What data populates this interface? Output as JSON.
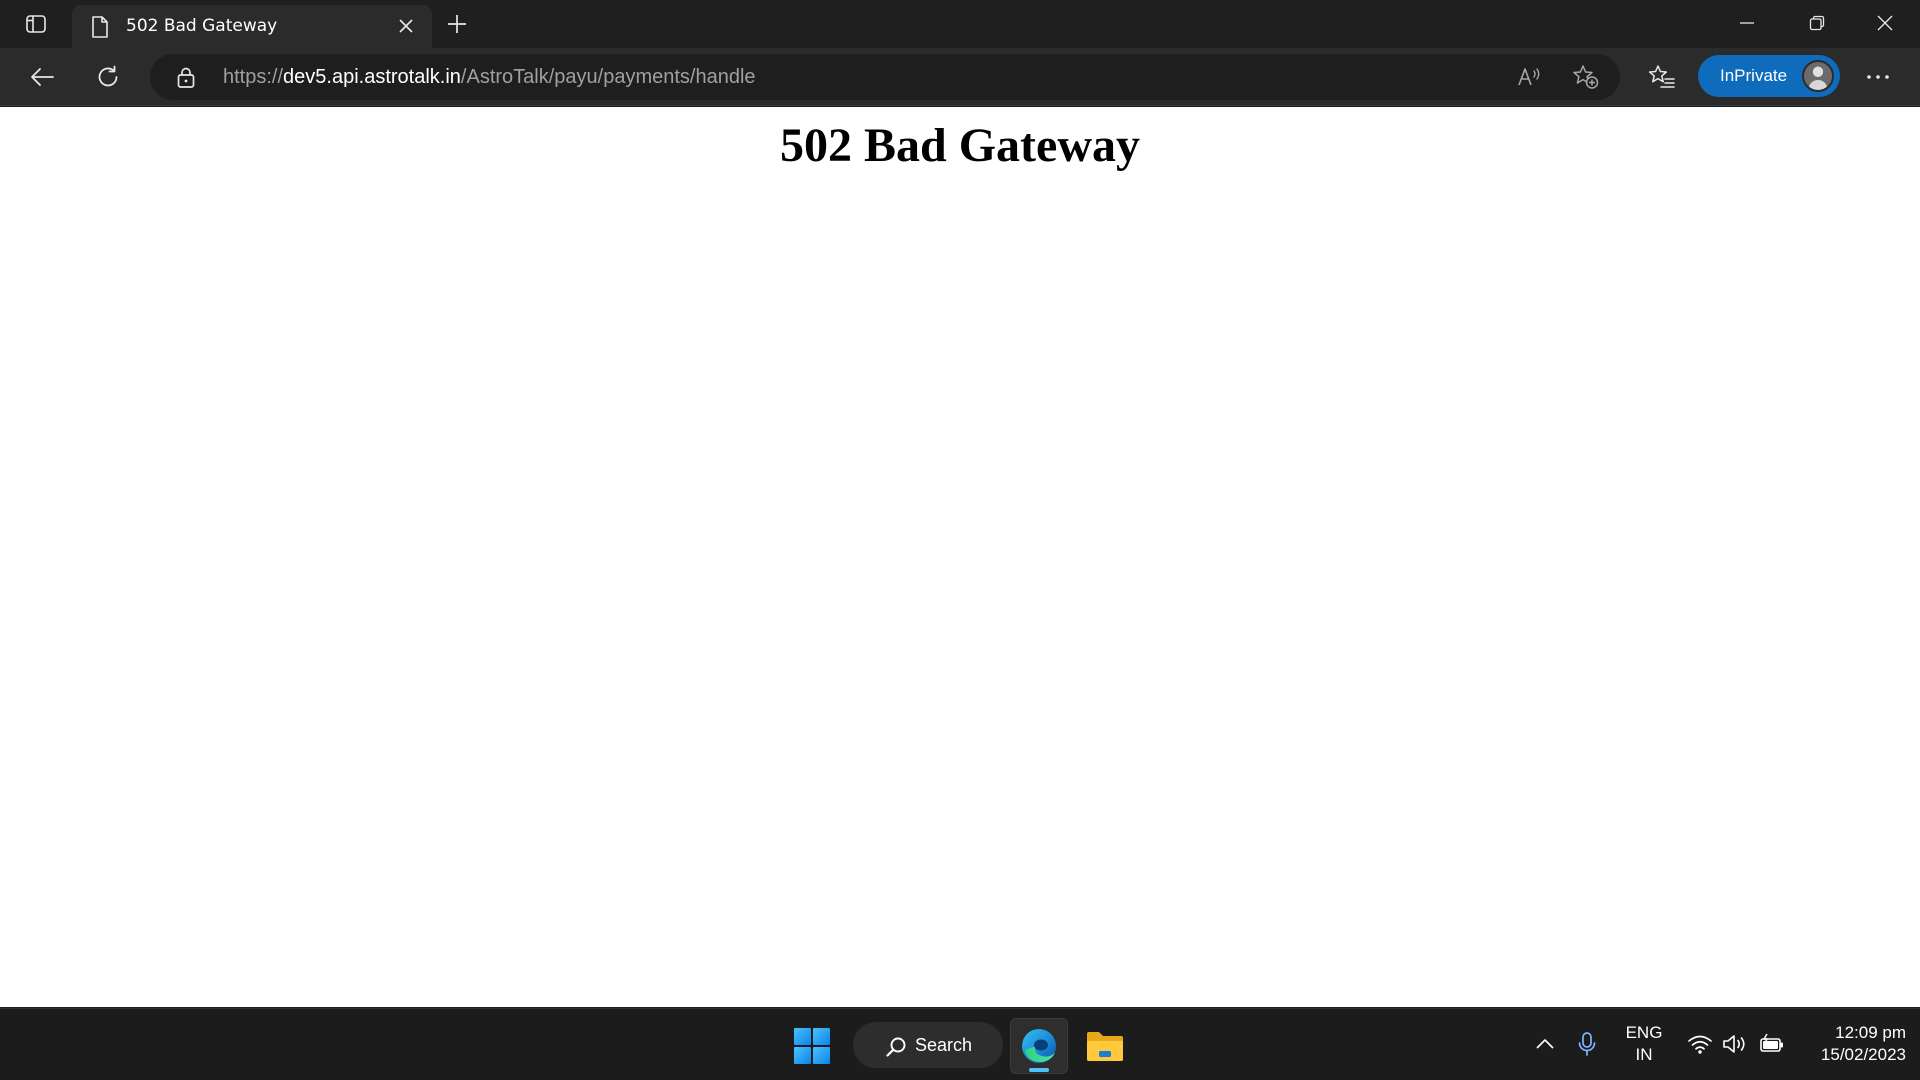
{
  "browser": {
    "tab": {
      "title": "502 Bad Gateway"
    },
    "address_bar": {
      "scheme": "https://",
      "host": "dev5.api.astrotalk.in",
      "path": "/AstroTalk/payu/payments/handle"
    },
    "profile": {
      "label": "InPrivate"
    },
    "icons": {
      "tab_actions": "tab-actions-icon",
      "tab_page": "document-icon",
      "tab_close": "close-icon",
      "new_tab": "plus-icon",
      "minimize": "minimize-icon",
      "restore": "restore-icon",
      "close_window": "close-icon",
      "back": "back-arrow-icon",
      "refresh": "refresh-icon",
      "lock": "lock-icon",
      "read_aloud": "read-aloud-icon",
      "add_favorite": "star-add-icon",
      "favorites": "favorites-icon",
      "more": "more-icon"
    }
  },
  "page": {
    "heading": "502 Bad Gateway"
  },
  "taskbar": {
    "search_label": "Search",
    "language": {
      "line1": "ENG",
      "line2": "IN"
    },
    "clock": {
      "time": "12:09 pm",
      "date": "15/02/2023"
    },
    "apps": [
      "windows-start-icon",
      "edge-icon",
      "file-explorer-icon"
    ],
    "tray": [
      "chevron-up-icon",
      "microphone-icon",
      "wifi-icon",
      "volume-icon",
      "battery-icon"
    ]
  },
  "colors": {
    "chrome_dark": "#1f1f1f",
    "toolbar": "#2b2b2b",
    "inprivate_blue": "#0f6cbd",
    "accent": "#4cc2ff"
  }
}
